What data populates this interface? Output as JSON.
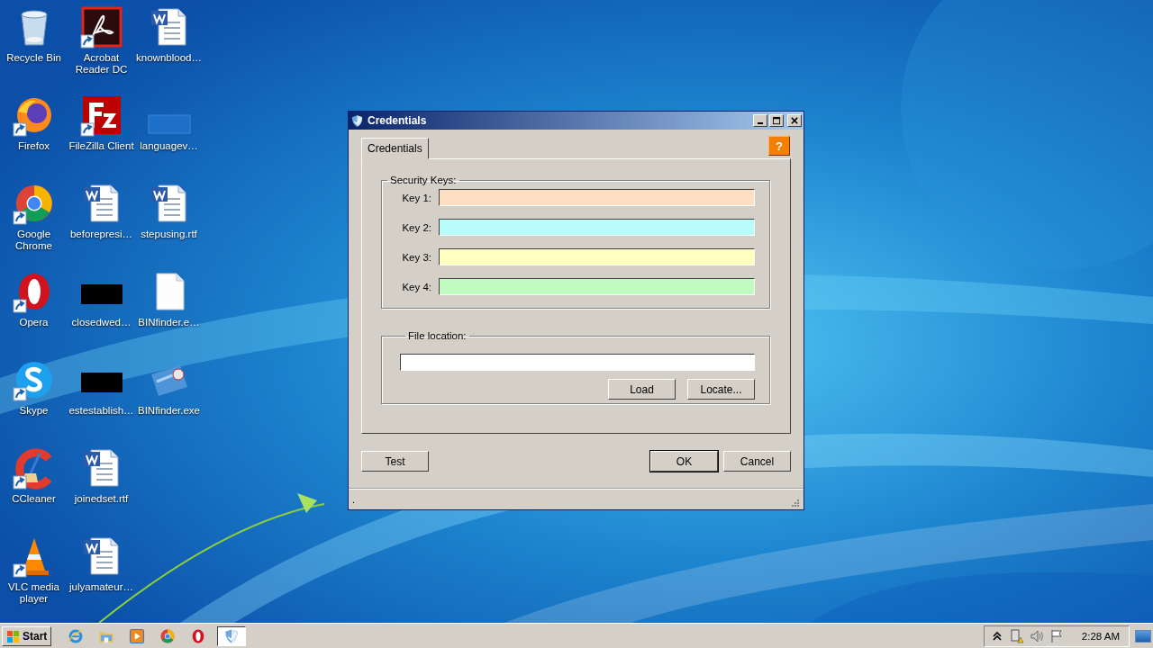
{
  "desktop": {
    "columns": [
      {
        "icons": [
          {
            "label": "Recycle Bin",
            "kind": "recycle",
            "shortcut": false
          },
          {
            "label": "Firefox",
            "kind": "firefox",
            "shortcut": true
          },
          {
            "label": "Google Chrome",
            "kind": "chrome",
            "shortcut": true
          },
          {
            "label": "Opera",
            "kind": "opera",
            "shortcut": true
          },
          {
            "label": "Skype",
            "kind": "skype",
            "shortcut": true
          },
          {
            "label": "CCleaner",
            "kind": "ccleaner",
            "shortcut": true
          },
          {
            "label": "VLC media player",
            "kind": "vlc",
            "shortcut": true
          }
        ]
      },
      {
        "icons": [
          {
            "label": "Acrobat Reader DC",
            "kind": "acrobat",
            "shortcut": true
          },
          {
            "label": "FileZilla Client",
            "kind": "filezilla",
            "shortcut": true
          },
          {
            "label": "beforepresi…",
            "kind": "word",
            "shortcut": false
          },
          {
            "label": "closedwed…",
            "kind": "black",
            "shortcut": false
          },
          {
            "label": "estestablish…",
            "kind": "black",
            "shortcut": false
          },
          {
            "label": "joinedset.rtf",
            "kind": "word",
            "shortcut": false
          },
          {
            "label": "julyamateur…",
            "kind": "word",
            "shortcut": false
          }
        ]
      },
      {
        "icons": [
          {
            "label": "knownblood…",
            "kind": "word",
            "shortcut": false
          },
          {
            "label": "languagev…",
            "kind": "strip",
            "shortcut": false
          },
          {
            "label": "stepusing.rtf",
            "kind": "word",
            "shortcut": false
          },
          {
            "label": "BINfinder.e…",
            "kind": "file",
            "shortcut": false
          },
          {
            "label": "BINfinder.exe",
            "kind": "card",
            "shortcut": false
          }
        ]
      }
    ]
  },
  "dialog": {
    "title": "Credentials",
    "tabs": [
      {
        "label": "Credentials",
        "selected": true
      }
    ],
    "help_button": "?",
    "security_keys": {
      "title": "Security Keys:",
      "keys": [
        {
          "label": "Key 1:",
          "color": "#fde0c4"
        },
        {
          "label": "Key 2:",
          "color": "#b8fcfc"
        },
        {
          "label": "Key 3:",
          "color": "#ffffc0"
        },
        {
          "label": "Key 4:",
          "color": "#c0fcc0"
        }
      ]
    },
    "file_location": {
      "title": "File location:",
      "buttons": [
        {
          "label": "Load",
          "default": false
        },
        {
          "label": "Locate...",
          "default": false
        }
      ]
    },
    "left_buttons": [
      {
        "label": "Test",
        "default": false
      }
    ],
    "right_buttons": [
      {
        "label": "OK",
        "default": true
      },
      {
        "label": "Cancel",
        "default": false
      }
    ],
    "status_text": "."
  },
  "taskbar": {
    "start": "Start",
    "apps": [
      {
        "kind": "ie",
        "selected": false
      },
      {
        "kind": "folder",
        "selected": false
      },
      {
        "kind": "media",
        "selected": false
      },
      {
        "kind": "chrome",
        "selected": false
      },
      {
        "kind": "opera",
        "selected": false
      },
      {
        "kind": "shield",
        "selected": true
      }
    ],
    "tray": [
      {
        "kind": "chevron"
      },
      {
        "kind": "network"
      },
      {
        "kind": "speaker"
      },
      {
        "kind": "flag"
      }
    ],
    "clock": "2:28 AM"
  }
}
